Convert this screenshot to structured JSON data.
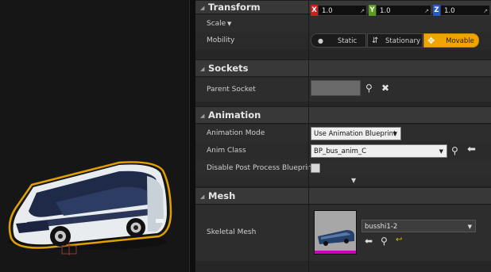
{
  "transform": {
    "title": "Transform",
    "scale_label": "Scale",
    "scale": {
      "x_axis": "X",
      "y_axis": "Y",
      "z_axis": "Z",
      "x": "1.0",
      "y": "1.0",
      "z": "1.0"
    },
    "mobility_label": "Mobility",
    "mobility_options": [
      "Static",
      "Stationary",
      "Movable"
    ],
    "mobility_selected": "Movable"
  },
  "sockets": {
    "title": "Sockets",
    "parent_socket_label": "Parent Socket",
    "parent_socket_value": ""
  },
  "animation": {
    "title": "Animation",
    "mode_label": "Animation Mode",
    "mode_value": "Use Animation Blueprint",
    "anim_class_label": "Anim Class",
    "anim_class_value": "BP_bus_anim_C",
    "disable_pp_label": "Disable Post Process Blueprint",
    "disable_pp_checked": false
  },
  "mesh": {
    "title": "Mesh",
    "skeletal_mesh_label": "Skeletal Mesh",
    "skeletal_mesh_value": "busshi1-2"
  },
  "colors": {
    "accent": "#f0a400",
    "x_axis": "#c8201a",
    "y_axis": "#5a9f1c",
    "z_axis": "#2659c9",
    "panel_bg": "#262626"
  }
}
